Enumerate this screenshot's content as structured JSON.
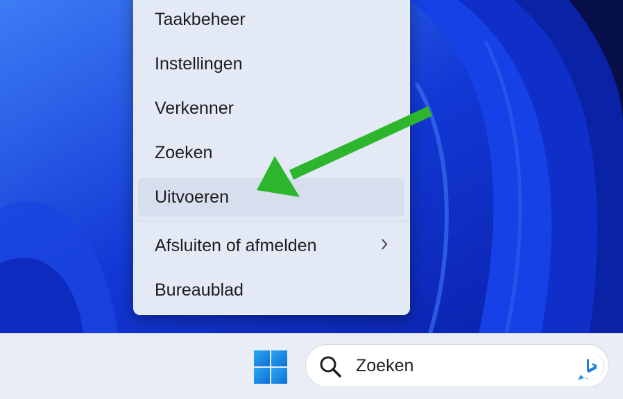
{
  "context_menu": {
    "items": [
      {
        "label": "Taakbeheer"
      },
      {
        "label": "Instellingen"
      },
      {
        "label": "Verkenner"
      },
      {
        "label": "Zoeken"
      },
      {
        "label": "Uitvoeren",
        "highlighted": true
      },
      {
        "label": "Afsluiten of afmelden",
        "submenu": true
      },
      {
        "label": "Bureaublad"
      }
    ],
    "submenu_icon": "chevron-right-icon"
  },
  "taskbar": {
    "start_icon": "windows-logo-icon",
    "search": {
      "placeholder": "Zoeken",
      "icon": "search-icon",
      "bing_icon": "bing-chat-icon"
    }
  },
  "annotation": {
    "arrow_color": "#2db52d"
  },
  "colors": {
    "wallpaper": "#1436d6",
    "menu_bg": "#e4e9f6",
    "taskbar_bg": "#e9edf5"
  }
}
